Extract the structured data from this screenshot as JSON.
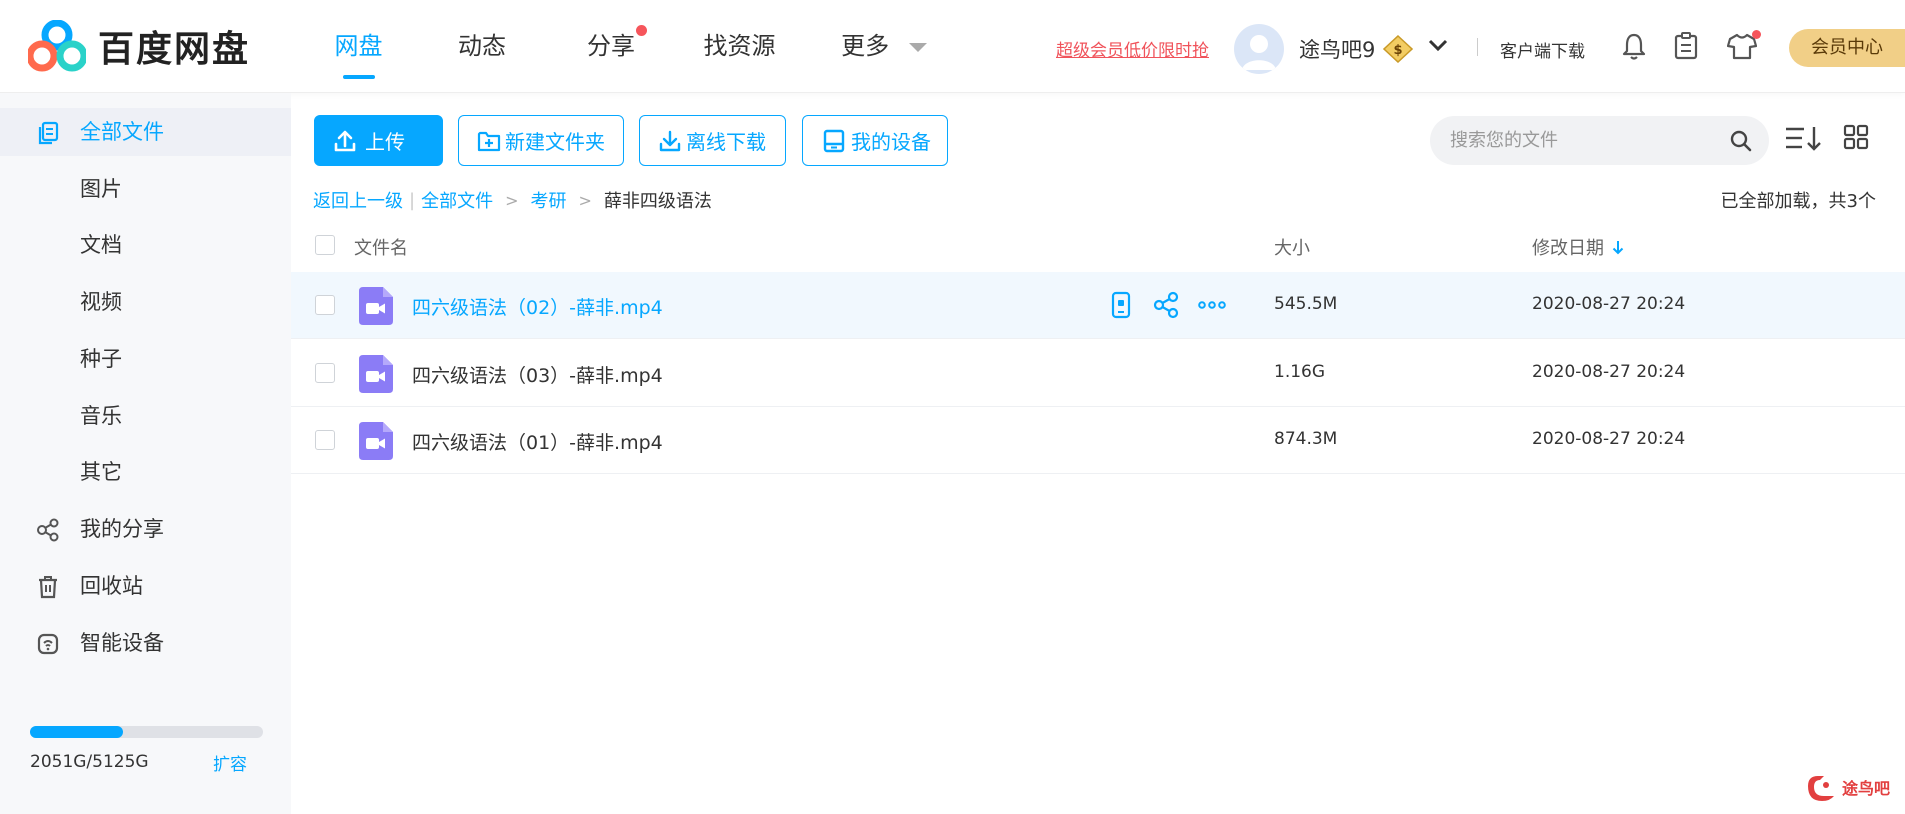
{
  "brand": {
    "name": "百度网盘",
    "accent": "#06a7ff"
  },
  "nav": {
    "items": [
      {
        "label": "网盘",
        "active": true
      },
      {
        "label": "动态"
      },
      {
        "label": "分享",
        "badge": true
      },
      {
        "label": "找资源"
      },
      {
        "label": "更多",
        "dropdown": true
      }
    ]
  },
  "header": {
    "promo": "超级会员低价限时抢",
    "username": "途鸟吧9",
    "client_download": "客户端下载",
    "vip_center": "会员中心"
  },
  "sidebar": {
    "items": [
      {
        "label": "全部文件",
        "icon": "file-stack-icon",
        "active": true
      },
      {
        "label": "图片"
      },
      {
        "label": "文档"
      },
      {
        "label": "视频"
      },
      {
        "label": "种子"
      },
      {
        "label": "音乐"
      },
      {
        "label": "其它"
      },
      {
        "label": "我的分享",
        "icon": "share-icon"
      },
      {
        "label": "回收站",
        "icon": "trash-icon"
      },
      {
        "label": "智能设备",
        "icon": "smart-device-icon"
      }
    ],
    "storage": {
      "used_text": "2051G/5125G",
      "used_fraction": 0.4,
      "expand_label": "扩容"
    }
  },
  "toolbar": {
    "upload": "上传",
    "new_folder": "新建文件夹",
    "offline_download": "离线下载",
    "my_devices": "我的设备",
    "search_placeholder": "搜索您的文件"
  },
  "breadcrumb": {
    "back": "返回上一级",
    "items": [
      "全部文件",
      "考研"
    ],
    "current": "薛非四级语法",
    "loaded_info": "已全部加载，共3个"
  },
  "table": {
    "headers": {
      "name": "文件名",
      "size": "大小",
      "date": "修改日期"
    },
    "rows": [
      {
        "name": "四六级语法（02）-薛非.mp4",
        "size": "545.5M",
        "date": "2020-08-27 20:24"
      },
      {
        "name": "四六级语法（03）-薛非.mp4",
        "size": "1.16G",
        "date": "2020-08-27 20:24"
      },
      {
        "name": "四六级语法（01）-薛非.mp4",
        "size": "874.3M",
        "date": "2020-08-27 20:24"
      }
    ]
  },
  "watermark": {
    "text": "途鸟吧"
  }
}
